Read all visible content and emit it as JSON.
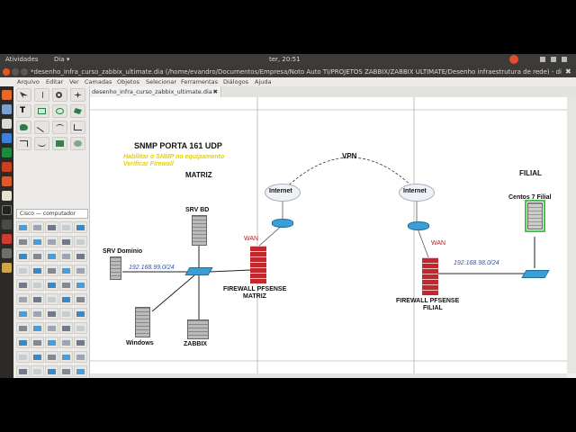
{
  "topbar": {
    "activities": "Atividades",
    "app_menu": "Dia ▾",
    "clock": "ter, 20:51"
  },
  "window": {
    "title": "*desenho_infra_curso_zabbix_ultimate.dia (/home/evandro/Documentos/Empresa/Noto Auto TI/PROJETOS ZABBIX/ZABBIX ULTIMATE/Desenho infraestrutura de rede) - dia"
  },
  "menu": [
    "Arquivo",
    "Editar",
    "Ver",
    "Camadas",
    "Objetos",
    "Selecionar",
    "Ferramentas",
    "Diálogos",
    "Ajuda"
  ],
  "toolbox": {
    "sheet_select": "Cisco — computador"
  },
  "tab": {
    "label": "desenho_infra_curso_zabbix_ultimate.dia",
    "close": "✖"
  },
  "diagram": {
    "heading": "SNMP PORTA 161 UDP",
    "note_line1": "Habilitar o SNMP no equipamento",
    "note_line2": "Verificar Firewall",
    "matriz": "MATRIZ",
    "filial": "FILIAL",
    "vpn": "VPN",
    "internet_left": "Internet",
    "internet_right": "Internet",
    "wan_left": "WAN",
    "wan_right": "WAN",
    "srv_bd": "SRV BD",
    "srv_dominio": "SRV Domínio",
    "windows": "Windows",
    "zabbix": "ZABBIX",
    "net_matriz": "192.168.99.0/24",
    "net_filial": "192.168.98.0/24",
    "fw_matriz_1": "FIREWALL PFSENSE",
    "fw_matriz_2": "MATRIZ",
    "fw_filial_1": "FIREWALL PFSENSE",
    "fw_filial_2": "FILIAL",
    "centos": "Centos 7 Filial"
  },
  "colors": {
    "accent": "#e95420",
    "note": "#e6d100",
    "network_label": "#3355aa",
    "wan": "#aa2222",
    "firewall": "#c0282d"
  }
}
